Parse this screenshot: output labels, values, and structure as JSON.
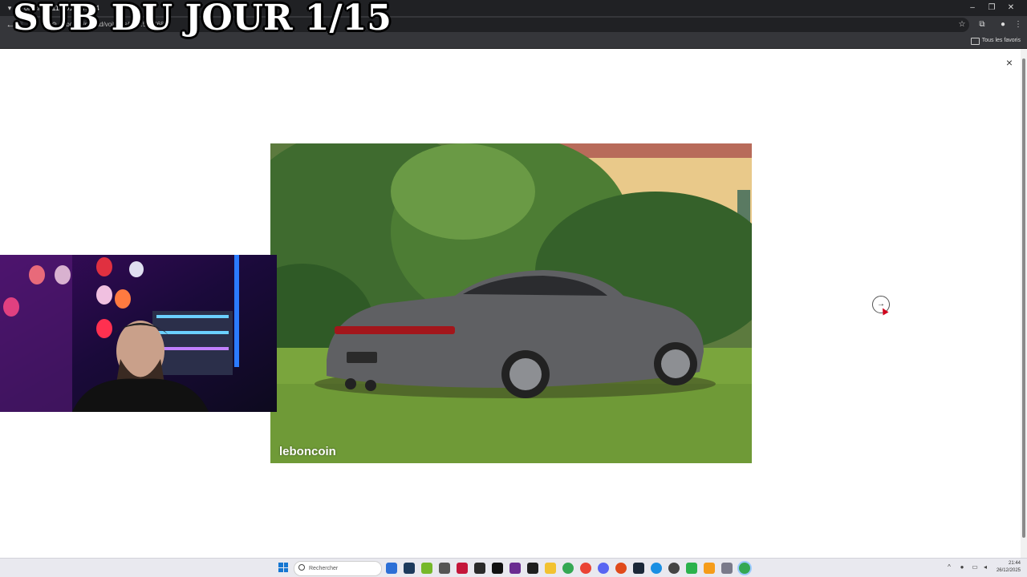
{
  "overlay": {
    "title": "SUB DU JOUR 1/15"
  },
  "browser": {
    "tab_title": "Porsche 911 991 Targa 4",
    "url": "leboncoin.fr/ad/voitures/30…572468",
    "bookmarks_all": "Tous les favoris"
  },
  "viewer": {
    "watermark": "leboncoin",
    "next_icon": "→",
    "close_icon": "×"
  },
  "taskbar": {
    "search_placeholder": "Rechercher",
    "time": "21:44",
    "date": "26/12/2025"
  },
  "colors": {
    "chrome_dark": "#202124",
    "chrome_toolbar": "#35363a",
    "taskbar": "#e9e9ef",
    "accent_blue": "#1677d2"
  }
}
